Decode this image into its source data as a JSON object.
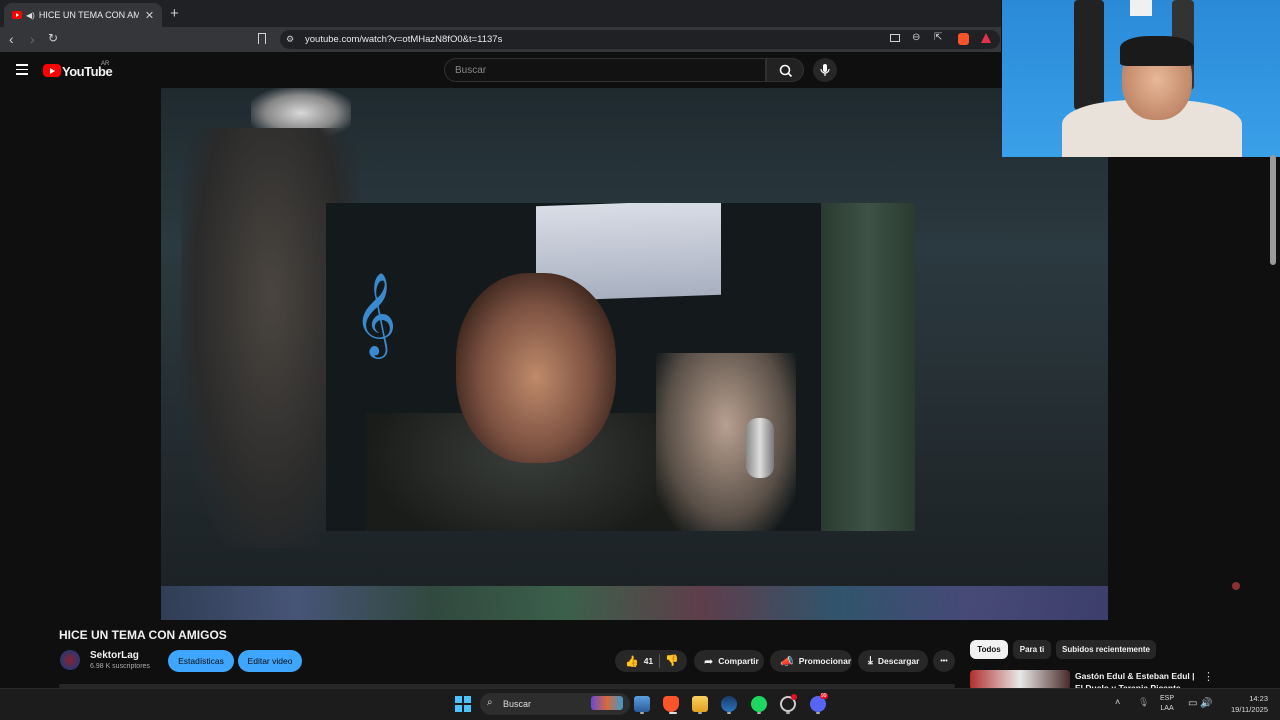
{
  "browser": {
    "tab_title": "HICE UN TEMA CON AMIGOS",
    "tab_close": "✕",
    "new_tab": "+",
    "url": "youtube.com/watch?v=otMHazN8fO0&t=1137s"
  },
  "youtube": {
    "logo_text": "YouTube",
    "region": "AR",
    "search_placeholder": "Buscar"
  },
  "video": {
    "title": "HICE UN TEMA CON AMIGOS",
    "channel": "SektorLag",
    "subscribers": "6.98 K suscriptores",
    "stats_button": "Estadísticas",
    "edit_button": "Editar video",
    "likes": "41",
    "share_label": "Compartir",
    "promote_label": "Promocionar",
    "download_label": "Descargar",
    "more_label": "•••"
  },
  "recommendations": {
    "chips": [
      "Todos",
      "Para ti",
      "Subidos recientemente"
    ],
    "first_title": "Gastón Edul & Esteban Edul | El Duelo y Terapia Picante"
  },
  "taskbar": {
    "search_label": "Buscar",
    "lang_top": "ESP",
    "lang_bottom": "LAA",
    "time": "14:23",
    "date": "19/11/2025",
    "discord_badge": "99"
  },
  "colors": {
    "accent": "#3ea6ff",
    "brand": "#ff0000",
    "background": "#0f0f0f"
  }
}
